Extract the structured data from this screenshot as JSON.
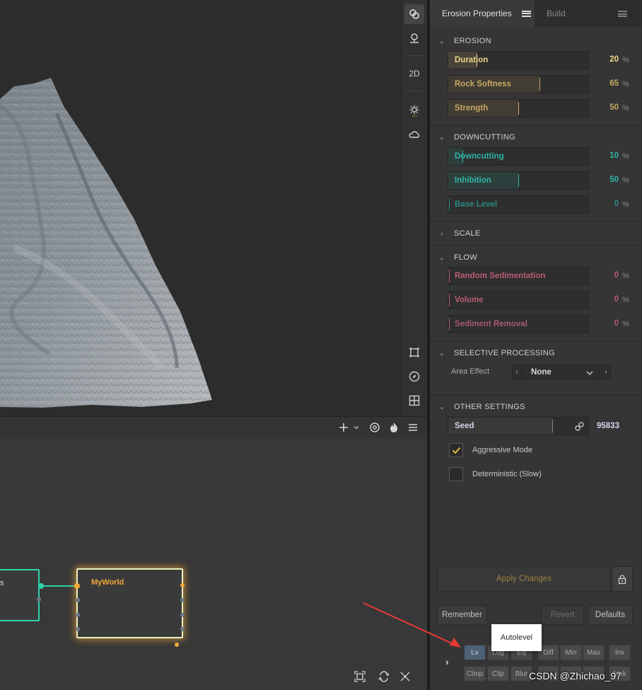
{
  "tabs": {
    "active": "Erosion Properties",
    "inactive": "Build"
  },
  "vtoolbar": {
    "mode_label": "2D"
  },
  "sections": {
    "erosion": {
      "title": "EROSION",
      "items": [
        {
          "label": "Duration",
          "value": 20,
          "unit": "%",
          "color": "#f2d38a"
        },
        {
          "label": "Rock Softness",
          "value": 65,
          "unit": "%",
          "color": "#c7a865"
        },
        {
          "label": "Strength",
          "value": 50,
          "unit": "%",
          "color": "#c7a865"
        }
      ]
    },
    "downcutting": {
      "title": "DOWNCUTTING",
      "items": [
        {
          "label": "Downcutting",
          "value": 10,
          "unit": "%",
          "color": "#2fb4a4"
        },
        {
          "label": "Inhibition",
          "value": 50,
          "unit": "%",
          "color": "#2fb4a4"
        },
        {
          "label": "Base Level",
          "value": 0,
          "unit": "%",
          "color": "#2a8a80"
        }
      ]
    },
    "scale": {
      "title": "SCALE"
    },
    "flow": {
      "title": "FLOW",
      "items": [
        {
          "label": "Random Sedimentation",
          "value": 0,
          "unit": "%",
          "color": "#b85b72"
        },
        {
          "label": "Volume",
          "value": 0,
          "unit": "%",
          "color": "#b85b72"
        },
        {
          "label": "Sediment Removal",
          "value": 0,
          "unit": "%",
          "color": "#a85a6e"
        }
      ]
    },
    "selective": {
      "title": "SELECTIVE PROCESSING",
      "area_label": "Area Effect",
      "area_value": "None"
    },
    "other": {
      "title": "OTHER SETTINGS",
      "seed_label": "Seed",
      "seed_value": "95833",
      "aggressive_label": "Aggressive Mode",
      "aggressive_checked": true,
      "deterministic_label": "Deterministic (Slow)",
      "deterministic_checked": false
    }
  },
  "buttons": {
    "apply": "Apply Changes",
    "remember": "Remember",
    "revert": "Revert",
    "defaults": "Defaults"
  },
  "mini_buttons_row1": [
    "Lv",
    "Log",
    "Eq",
    "Diff",
    "Min",
    "Max",
    "Inv"
  ],
  "mini_buttons_row2": [
    "Clmp",
    "Clip",
    "Blur",
    "",
    "",
    "",
    "Msk"
  ],
  "tooltip": "Autolevel",
  "graph": {
    "node_main": "MyWorld",
    "node_left_partial": "s"
  },
  "watermark": "CSDN @Zhichao_97",
  "colors": {
    "accent_orange": "#f2a93b",
    "node_green": "#2fd3a8",
    "annotation_red": "#e53935"
  }
}
